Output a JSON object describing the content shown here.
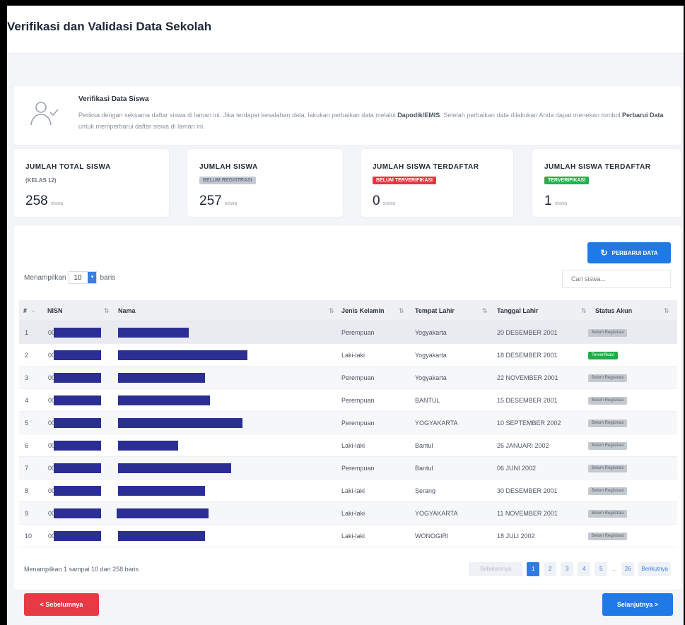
{
  "page": {
    "title": "Verifikasi dan Validasi Data Sekolah"
  },
  "info": {
    "title": "Verifikasi Data Siswa",
    "text_1": "Periksa dengan seksama daftar siswa di laman ini. Jika terdapat kesalahan data, lakukan perbaikan data melalui ",
    "text_bold_1": "Dapodik/EMIS",
    "text_2": ". Setelah perbaikan data dilakukan Anda dapat menekan tombol ",
    "text_bold_2": "Perbarui Data",
    "text_3": " untuk memperbarui daftar siswa di laman ini."
  },
  "stats": [
    {
      "label": "JUMLAH TOTAL SISWA",
      "sub": "(KELAS 12)",
      "value": "258",
      "unit": "siswa"
    },
    {
      "label": "JUMLAH SISWA",
      "badge": "BELUM REGISTRASI",
      "value": "257",
      "unit": "siswa"
    },
    {
      "label": "JUMLAH SISWA TERDAFTAR",
      "badge": "BELUM TERVERIFIKASI",
      "value": "0",
      "unit": "siswa"
    },
    {
      "label": "JUMLAH SISWA TERDAFTAR",
      "badge": "TERVERIFIKASI",
      "value": "1",
      "unit": "siswa"
    }
  ],
  "toolbar": {
    "refresh_label": "PERBARUI DATA",
    "show_prefix": "Menampilkan",
    "show_value": "10",
    "show_suffix": "baris",
    "search_placeholder": "Cari siswa..."
  },
  "table": {
    "columns": [
      "#",
      "NISN",
      "Nama",
      "Jenis Kelamin",
      "Tempat Lahir",
      "Tanggal Lahir",
      "Status Akun"
    ],
    "rows": [
      {
        "no": "1",
        "nisn": "00",
        "gender": "Perempuan",
        "birthplace": "Yogyakarta",
        "birthdate": "20 DESEMBER 2001",
        "status": "Belum Registrasi"
      },
      {
        "no": "2",
        "nisn": "00",
        "gender": "Laki-laki",
        "birthplace": "Yogyakarta",
        "birthdate": "18 DESEMBER 2001",
        "status": "Terverifikasi"
      },
      {
        "no": "3",
        "nisn": "00",
        "gender": "Perempuan",
        "birthplace": "Yogyakarta",
        "birthdate": "22 NOVEMBER 2001",
        "status": "Belum Registrasi"
      },
      {
        "no": "4",
        "nisn": "00",
        "gender": "Perempuan",
        "birthplace": "BANTUL",
        "birthdate": "15 DESEMBER 2001",
        "status": "Belum Registrasi"
      },
      {
        "no": "5",
        "nisn": "00",
        "gender": "Perempuan",
        "birthplace": "YOGYAKARTA",
        "birthdate": "10 SEPTEMBER 2002",
        "status": "Belum Registrasi"
      },
      {
        "no": "6",
        "nisn": "00",
        "gender": "Laki-laki",
        "birthplace": "Bantul",
        "birthdate": "26 JANUARI 2002",
        "status": "Belum Registrasi"
      },
      {
        "no": "7",
        "nisn": "00",
        "gender": "Perempuan",
        "birthplace": "Bantul",
        "birthdate": "06 JUNI 2002",
        "status": "Belum Registrasi"
      },
      {
        "no": "8",
        "nisn": "00",
        "gender": "Laki-laki",
        "birthplace": "Serang",
        "birthdate": "30 DESEMBER 2001",
        "status": "Belum Registrasi"
      },
      {
        "no": "9",
        "nisn": "00",
        "gender": "Laki-laki",
        "birthplace": "YOGYAKARTA",
        "birthdate": "11 NOVEMBER 2001",
        "status": "Belum Registrasi"
      },
      {
        "no": "10",
        "nisn": "00",
        "gender": "Laki-laki",
        "birthplace": "WONOGIRI",
        "birthdate": "18 JULI 2002",
        "status": "Belum Registrasi"
      }
    ]
  },
  "footer": {
    "info": "Menampilkan 1 sampai 10 dari 258 baris",
    "prev_page": "Sebelumnya",
    "pages": [
      "1",
      "2",
      "3",
      "4",
      "5",
      "...",
      "26"
    ],
    "next_page": "Berikutnya"
  },
  "nav": {
    "prev_label": "< Sebelumnya",
    "next_label": "Selanjutnya >"
  },
  "colors": {
    "primary": "#1e7ae6",
    "danger": "#e63a44",
    "success": "#22b14c",
    "redaction": "#2b2f93"
  }
}
